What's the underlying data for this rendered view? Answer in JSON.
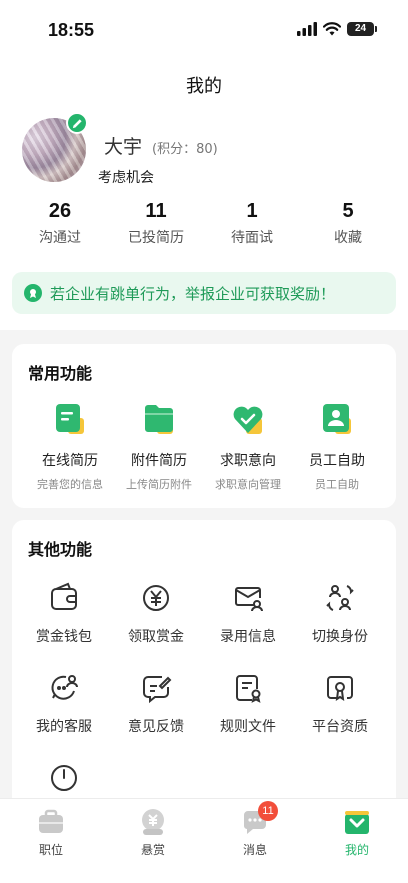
{
  "status_bar": {
    "time": "18:55",
    "battery": "24"
  },
  "header": {
    "title": "我的"
  },
  "profile": {
    "name": "大宇",
    "points": "(积分：80)",
    "status": "考虑机会"
  },
  "stats": [
    {
      "value": "26",
      "label": "沟通过"
    },
    {
      "value": "11",
      "label": "已投简历"
    },
    {
      "value": "1",
      "label": "待面试"
    },
    {
      "value": "5",
      "label": "收藏"
    }
  ],
  "banner": {
    "text": "若企业有跳单行为，举报企业可获取奖励！"
  },
  "common_functions": {
    "title": "常用功能",
    "items": [
      {
        "label": "在线简历",
        "sub": "完善您的信息",
        "icon": "online-resume-icon"
      },
      {
        "label": "附件简历",
        "sub": "上传简历附件",
        "icon": "attachment-resume-icon"
      },
      {
        "label": "求职意向",
        "sub": "求职意向管理",
        "icon": "job-intention-icon"
      },
      {
        "label": "员工自助",
        "sub": "员工自助",
        "icon": "employee-self-service-icon"
      }
    ]
  },
  "other_functions": {
    "title": "其他功能",
    "items": [
      {
        "label": "赏金钱包",
        "icon": "wallet-icon"
      },
      {
        "label": "领取赏金",
        "icon": "yuan-coin-icon"
      },
      {
        "label": "录用信息",
        "icon": "offer-mail-icon"
      },
      {
        "label": "切换身份",
        "icon": "switch-identity-icon"
      },
      {
        "label": "我的客服",
        "icon": "customer-service-icon"
      },
      {
        "label": "意见反馈",
        "icon": "feedback-icon"
      },
      {
        "label": "规则文件",
        "icon": "rules-document-icon"
      },
      {
        "label": "平台资质",
        "icon": "platform-qualification-icon"
      },
      {
        "label": "",
        "icon": "power-icon"
      }
    ]
  },
  "tabbar": {
    "items": [
      {
        "label": "职位",
        "icon": "briefcase-icon"
      },
      {
        "label": "悬赏",
        "icon": "reward-icon"
      },
      {
        "label": "消息",
        "icon": "message-icon",
        "badge": "11"
      },
      {
        "label": "我的",
        "icon": "profile-icon",
        "active": true
      }
    ]
  },
  "colors": {
    "accent": "#24b56c",
    "banner_bg": "#e9f8ef",
    "badge": "#f24e3a"
  }
}
